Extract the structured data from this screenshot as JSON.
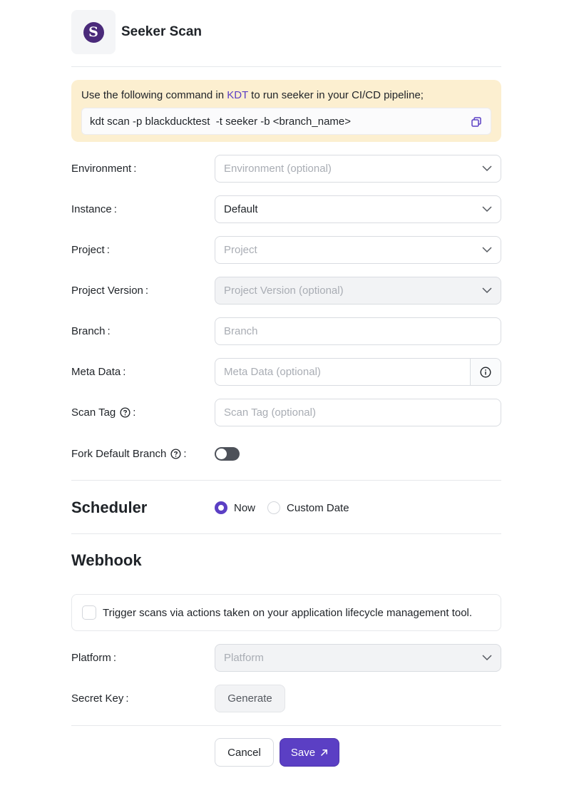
{
  "header": {
    "logo_letter": "S",
    "title": "Seeker Scan",
    "logo_color": "#4a2a7a"
  },
  "notice": {
    "text_before": "Use the following command in ",
    "link": "KDT",
    "text_after": " to run seeker in your CI/CD pipeline;",
    "command": "kdt scan -p blackducktest  -t seeker -b <branch_name>",
    "copy_icon": "copy-icon"
  },
  "form": {
    "environment": {
      "label": "Environment",
      "placeholder": "Environment (optional)"
    },
    "instance": {
      "label": "Instance",
      "value": "Default"
    },
    "project": {
      "label": "Project",
      "placeholder": "Project"
    },
    "project_version": {
      "label": "Project Version",
      "placeholder": "Project Version (optional)"
    },
    "branch": {
      "label": "Branch",
      "placeholder": "Branch"
    },
    "meta_data": {
      "label": "Meta Data",
      "placeholder": "Meta Data (optional)",
      "icon": "info-icon"
    },
    "scan_tag": {
      "label": "Scan Tag",
      "placeholder": "Scan Tag (optional)",
      "icon": "help-icon"
    },
    "fork_default_branch": {
      "label": "Fork Default Branch",
      "enabled": false,
      "icon": "help-icon"
    },
    "colon": ":"
  },
  "scheduler": {
    "title": "Scheduler",
    "options": [
      {
        "label": "Now",
        "checked": true
      },
      {
        "label": "Custom Date",
        "checked": false
      }
    ]
  },
  "webhook": {
    "title": "Webhook",
    "trigger_text": "Trigger scans via actions taken on your application lifecycle management tool.",
    "trigger_checked": false,
    "platform": {
      "label": "Platform",
      "placeholder": "Platform"
    },
    "secret_key": {
      "label": "Secret Key",
      "button": "Generate"
    }
  },
  "actions": {
    "cancel": "Cancel",
    "save": "Save"
  },
  "colors": {
    "accent": "#5b3fc4",
    "notice_bg": "#fcefd0"
  }
}
